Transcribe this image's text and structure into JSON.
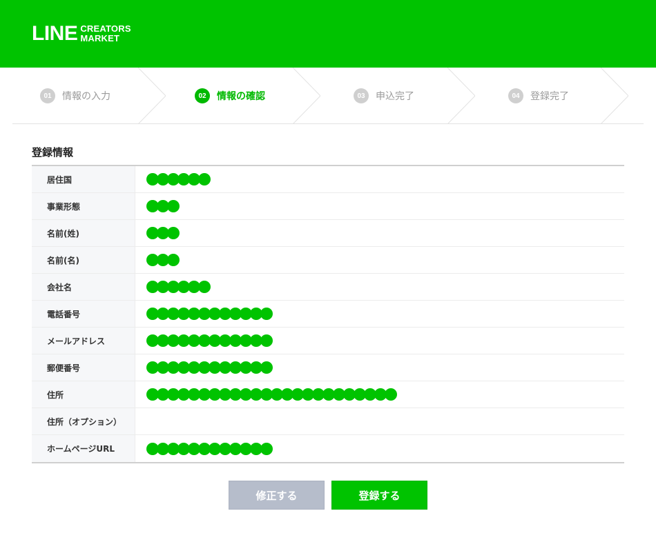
{
  "header": {
    "logo_main": "LINE",
    "logo_sub_1": "CREATORS",
    "logo_sub_2": "MARKET",
    "brand_color": "#00c300"
  },
  "steps": [
    {
      "num": "01",
      "label": "情報の入力",
      "active": false
    },
    {
      "num": "02",
      "label": "情報の確認",
      "active": true
    },
    {
      "num": "03",
      "label": "申込完了",
      "active": false
    },
    {
      "num": "04",
      "label": "登録完了",
      "active": false
    }
  ],
  "section": {
    "title": "登録情報"
  },
  "rows": [
    {
      "label": "居住国",
      "masked_dots": 6
    },
    {
      "label": "事業形態",
      "masked_dots": 3
    },
    {
      "label": "名前(姓)",
      "masked_dots": 3
    },
    {
      "label": "名前(名)",
      "masked_dots": 3
    },
    {
      "label": "会社名",
      "masked_dots": 6
    },
    {
      "label": "電話番号",
      "masked_dots": 12
    },
    {
      "label": "メールアドレス",
      "masked_dots": 12
    },
    {
      "label": "郵便番号",
      "masked_dots": 12
    },
    {
      "label": "住所",
      "masked_dots": 24
    },
    {
      "label": "住所（オプション）",
      "masked_dots": 0
    },
    {
      "label": "ホームページURL",
      "masked_dots": 12
    }
  ],
  "buttons": {
    "edit_label": "修正する",
    "register_label": "登録する"
  }
}
